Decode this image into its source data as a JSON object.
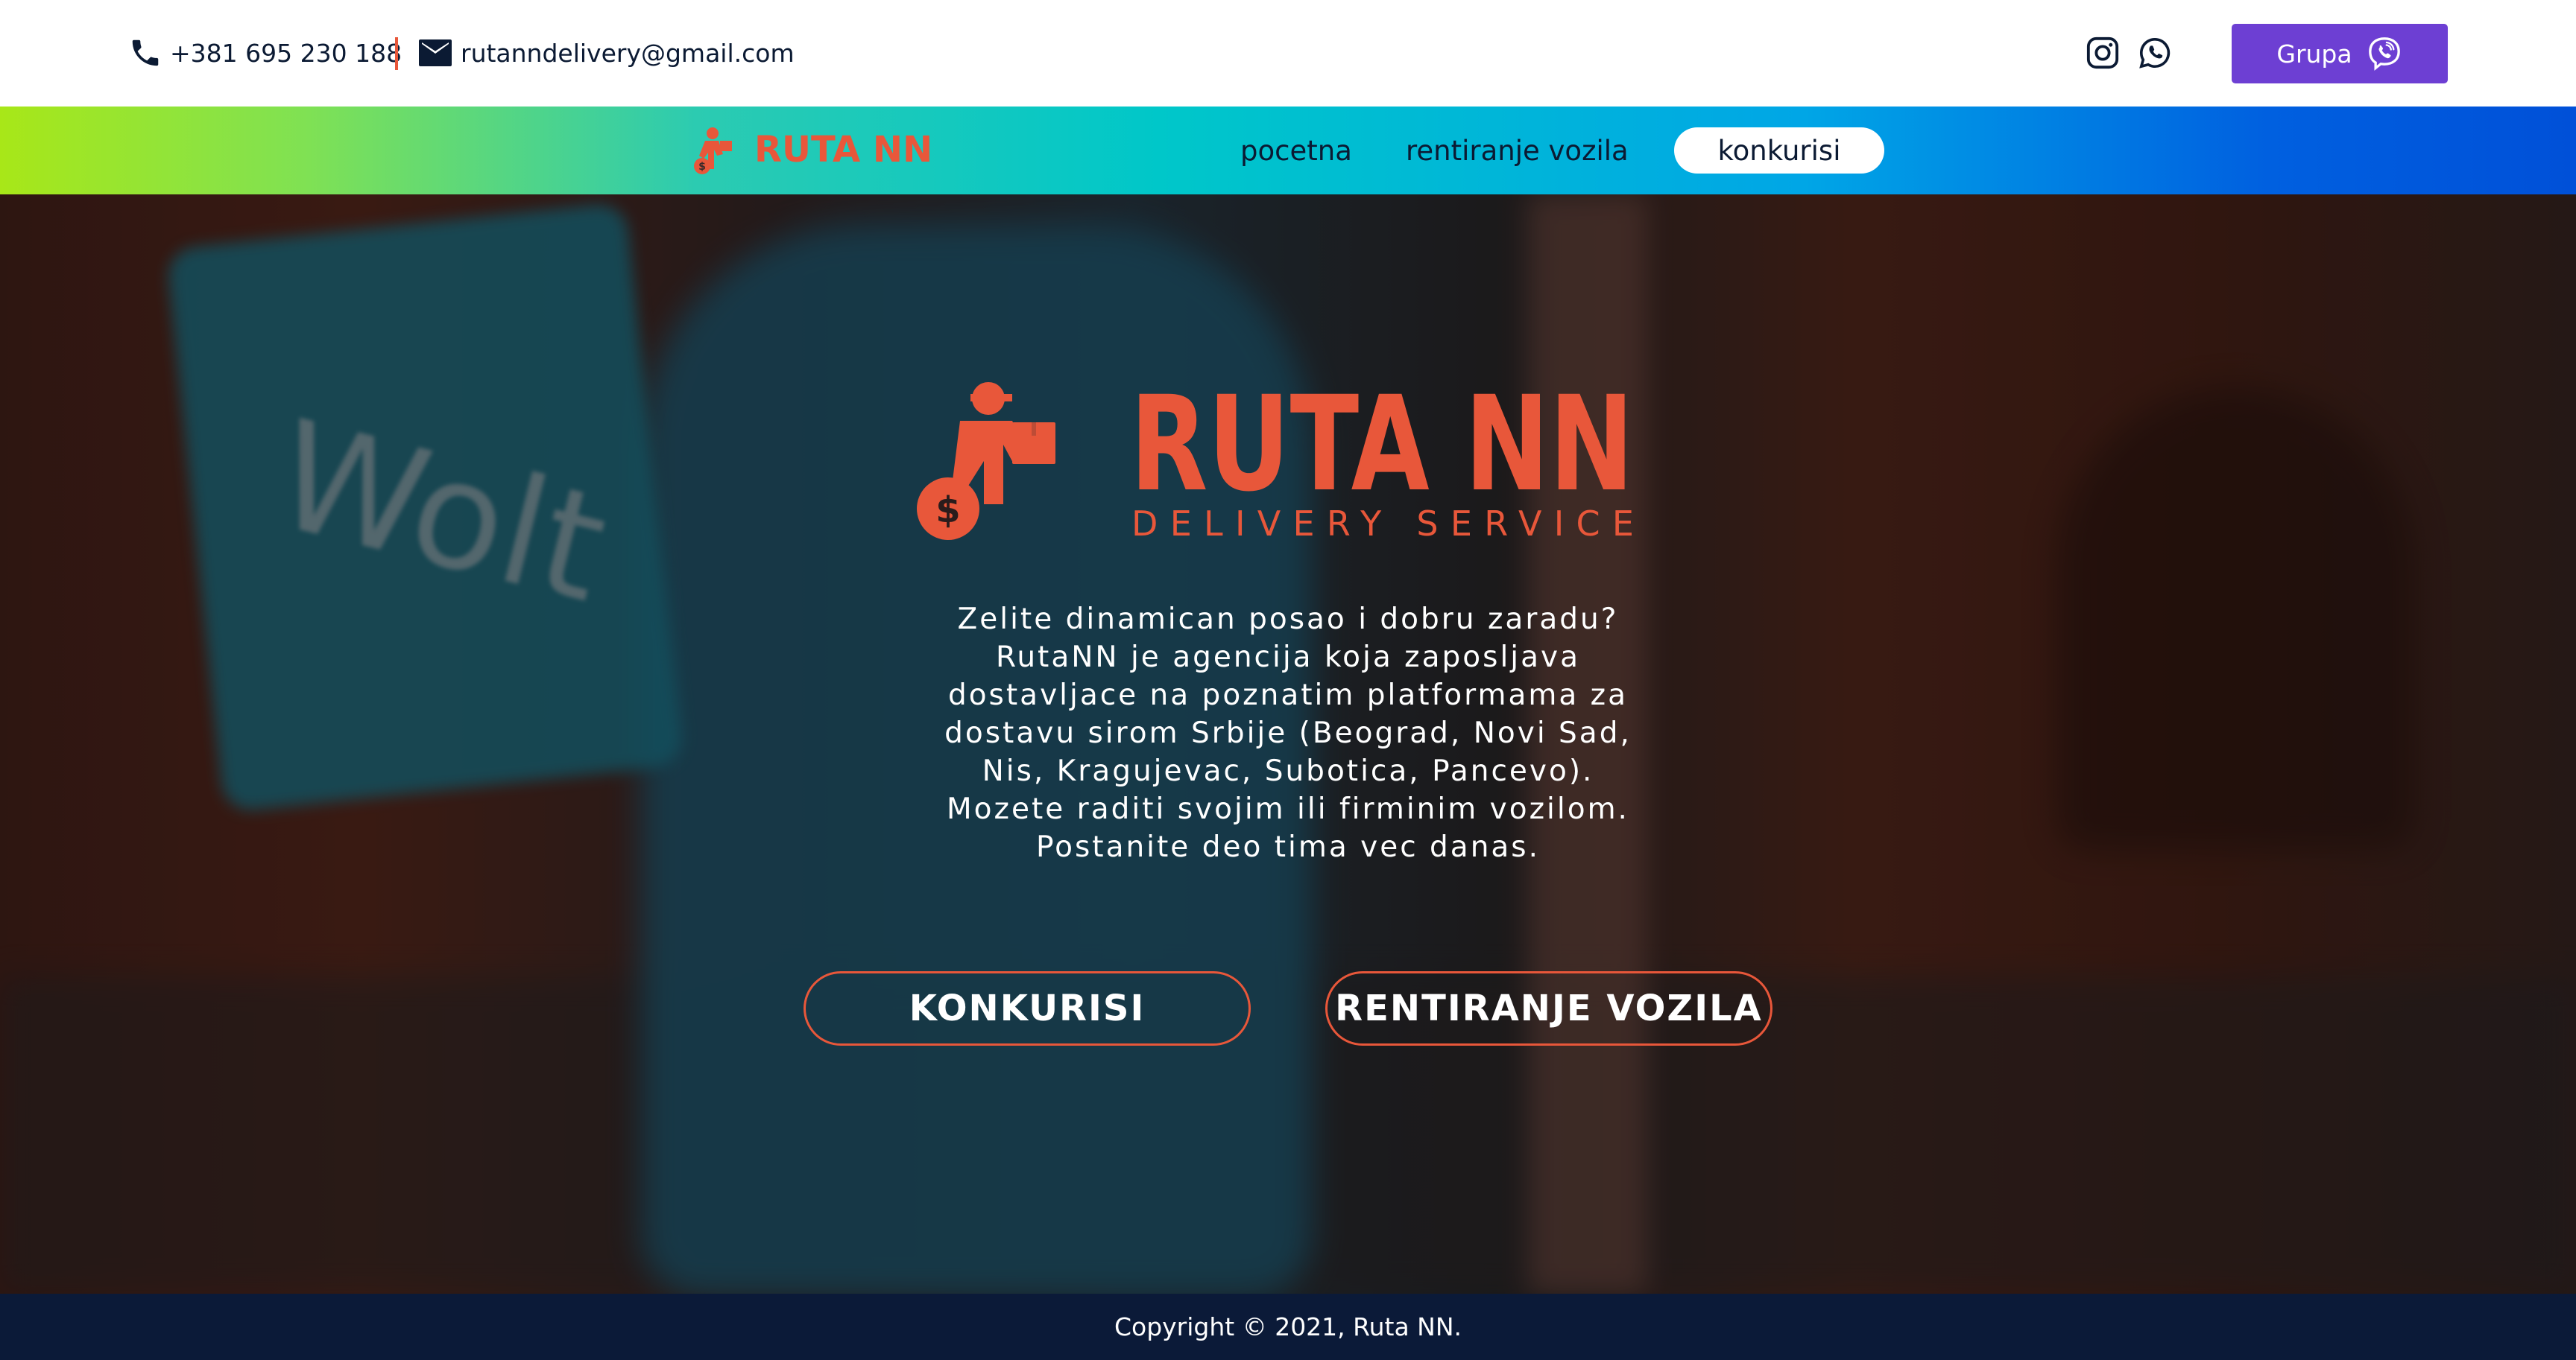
{
  "topbar": {
    "phone": "+381 695 230 188",
    "email": "rutanndelivery@gmail.com",
    "social_icons": [
      "instagram-icon",
      "whatsapp-icon"
    ],
    "group_button_label": "Grupa",
    "group_button_icon": "viber-icon"
  },
  "nav": {
    "logo_text": "RUTA NN",
    "items": [
      {
        "label": "pocetna"
      },
      {
        "label": "rentiranje vozila"
      },
      {
        "label": "konkurisi",
        "active": true
      }
    ]
  },
  "hero": {
    "logo_title": "RUTA NN",
    "logo_subtitle": "DELIVERY SERVICE",
    "description_lines": [
      "Zelite dinamican posao i dobru zaradu?",
      "RutaNN je agencija koja zaposljava",
      "dostavljace na poznatim platformama za",
      "dostavu sirom Srbije (Beograd, Novi Sad,",
      "Nis, Kragujevac, Subotica, Pancevo).",
      "Mozete raditi svojim ili firminim vozilom.",
      "Postanite deo tima vec danas."
    ],
    "background_text": "Wolt",
    "cta_primary": "KONKURISI",
    "cta_secondary": "RENTIRANJE VOZILA"
  },
  "footer": {
    "copyright": "Copyright © 2021, Ruta NN."
  },
  "colors": {
    "brand_orange": "#e8573a",
    "viber_purple": "#6d3fd3",
    "footer_navy": "#0b1a38",
    "nav_gradient_start": "#a8e718",
    "nav_gradient_end": "#0050d8"
  }
}
